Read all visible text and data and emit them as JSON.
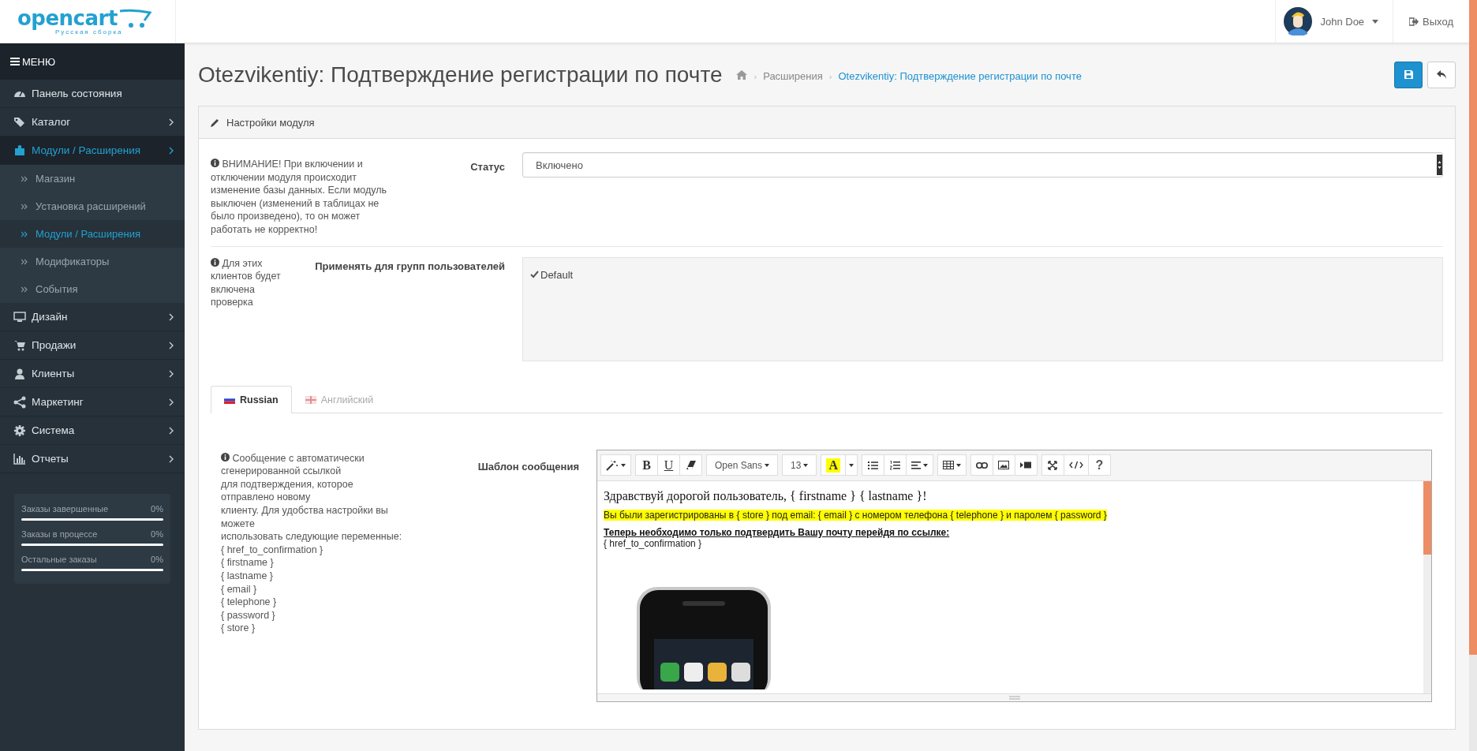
{
  "header": {
    "logo": {
      "name": "opencart",
      "subtitle": "Русская сборка"
    },
    "user": {
      "name": "John Doe"
    },
    "logout": "Выход"
  },
  "sidebar": {
    "menu_label": "МЕНЮ",
    "items": [
      {
        "label": "Панель состояния",
        "kind": "link",
        "selected": false
      },
      {
        "label": "Каталог",
        "kind": "menu",
        "selected": false,
        "expanded": false
      },
      {
        "label": "Модули / Расширения",
        "kind": "menu",
        "selected": true,
        "expanded": true,
        "children": [
          {
            "label": "Магазин",
            "selected": false
          },
          {
            "label": "Установка расширений",
            "selected": false
          },
          {
            "label": "Модули / Расширения",
            "selected": true
          },
          {
            "label": "Модификаторы",
            "selected": false
          },
          {
            "label": "События",
            "selected": false
          }
        ]
      },
      {
        "label": "Дизайн",
        "kind": "menu",
        "selected": false,
        "expanded": false
      },
      {
        "label": "Продажи",
        "kind": "menu",
        "selected": false,
        "expanded": false
      },
      {
        "label": "Клиенты",
        "kind": "menu",
        "selected": false,
        "expanded": false
      },
      {
        "label": "Маркетинг",
        "kind": "menu",
        "selected": false,
        "expanded": false
      },
      {
        "label": "Система",
        "kind": "menu",
        "selected": false,
        "expanded": false
      },
      {
        "label": "Отчеты",
        "kind": "menu",
        "selected": false,
        "expanded": false
      }
    ],
    "stats": [
      {
        "label": "Заказы завершенные",
        "value": "0%",
        "level": 0
      },
      {
        "label": "Заказы в процессе",
        "value": "0%",
        "level": 0
      },
      {
        "label": "Остальные заказы",
        "value": "0%",
        "level": 0
      }
    ]
  },
  "page": {
    "title": "Otezvikentiy: Подтверждение регистрации по почте",
    "breadcrumb_separator": "›",
    "breadcrumb": [
      {
        "label": "Расширения",
        "selected": false
      },
      {
        "label": "Otezvikentiy: Подтверждение регистрации по почте",
        "selected": true
      }
    ]
  },
  "panel": {
    "title": "Настройки модуля",
    "rows": [
      {
        "kind": "select",
        "note": "ВНИМАНИЕ! При включении и отключении модуля происходит изменение базы данных. Если модуль выключен (изменений в таблицах не было произведено), то он может работать не корректно!",
        "label": "Статус",
        "value": "Включено"
      },
      {
        "kind": "checklist",
        "note": "Для этих клиентов будет включена проверка",
        "label": "Применять для групп пользователей",
        "options": [
          {
            "label": "Default",
            "checked": true
          }
        ]
      }
    ],
    "tabs": [
      {
        "label": "Russian",
        "selected": true
      },
      {
        "label": "Английский",
        "selected": false
      }
    ],
    "template": {
      "note": "Сообщение с автоматически\nсгенерированной ссылкой\nдля подтверждения, которое\nотправлено новому\nклиенту. Для удобства настройки вы\nможете\nиспользовать следующие переменные:\n{ href_to_confirmation }\n{ firstname }\n{ lastname }\n{ email }\n{ telephone }\n{ password }\n{ store }",
      "label": "Шаблон сообщения",
      "toolbar": {
        "bold": "B",
        "underline": "U",
        "font": "Open Sans",
        "size": "13",
        "highlight_letter": "A",
        "help": "?"
      },
      "content": {
        "greeting": "Здравствуй дорогой пользователь, { firstname } { lastname }!",
        "highlight": "Вы были зарегистрированы в { store } под email: { email } с номером телефона { telephone } и паролем { password }",
        "instruction": "Теперь необходимо только подтвердить Вашу почту перейдя по ссылке:",
        "link": "{ href_to_confirmation }"
      }
    }
  }
}
